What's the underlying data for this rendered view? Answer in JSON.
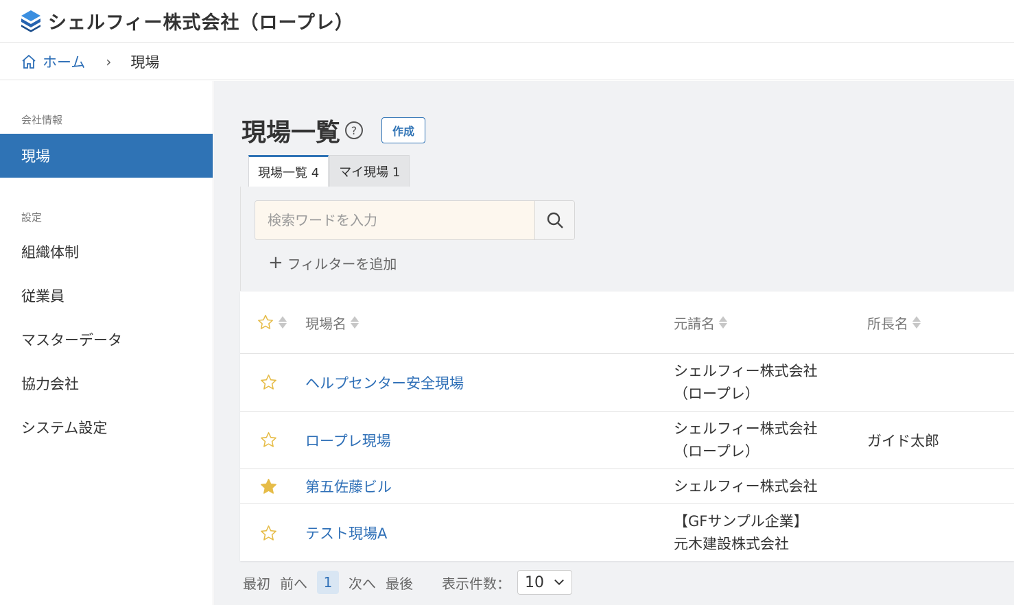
{
  "header": {
    "company_name": "シェルフィー株式会社（ロープレ）"
  },
  "breadcrumb": {
    "home": "ホーム",
    "separator": "›",
    "current": "現場"
  },
  "sidebar": {
    "sections": [
      {
        "title": "会社情報",
        "items": [
          {
            "label": "現場",
            "active": true
          }
        ]
      },
      {
        "title": "設定",
        "items": [
          {
            "label": "組織体制"
          },
          {
            "label": "従業員"
          },
          {
            "label": "マスターデータ"
          },
          {
            "label": "協力会社"
          },
          {
            "label": "システム設定"
          }
        ]
      }
    ]
  },
  "main": {
    "title": "現場一覧",
    "create_label": "作成",
    "tabs": [
      {
        "label": "現場一覧 4",
        "active": true
      },
      {
        "label": "マイ現場 1"
      }
    ],
    "search": {
      "placeholder": "検索ワードを入力"
    },
    "add_filter": "フィルターを追加",
    "table": {
      "headers": {
        "name": "現場名",
        "prime": "元請名",
        "chief": "所長名"
      },
      "rows": [
        {
          "starred": false,
          "name": "ヘルプセンター安全現場",
          "prime_1": "シェルフィー株式会社",
          "prime_2": "（ロープレ）",
          "chief": ""
        },
        {
          "starred": false,
          "name": "ロープレ現場",
          "prime_1": "シェルフィー株式会社",
          "prime_2": "（ロープレ）",
          "chief": "ガイド太郎"
        },
        {
          "starred": true,
          "name": "第五佐藤ビル",
          "prime_1": "シェルフィー株式会社",
          "prime_2": "",
          "chief": ""
        },
        {
          "starred": false,
          "name": "テスト現場A",
          "prime_1": "【GFサンプル企業】",
          "prime_2": "元木建設株式会社",
          "chief": ""
        }
      ]
    },
    "pager": {
      "first": "最初",
      "prev": "前へ",
      "page": "1",
      "next": "次へ",
      "last": "最後",
      "per_page_label": "表示件数：",
      "per_page_value": "10"
    }
  },
  "colors": {
    "accent": "#2f73b5",
    "link": "#2e6fb7",
    "star": "#e6bc48",
    "search_bg": "#fdf7ee"
  }
}
